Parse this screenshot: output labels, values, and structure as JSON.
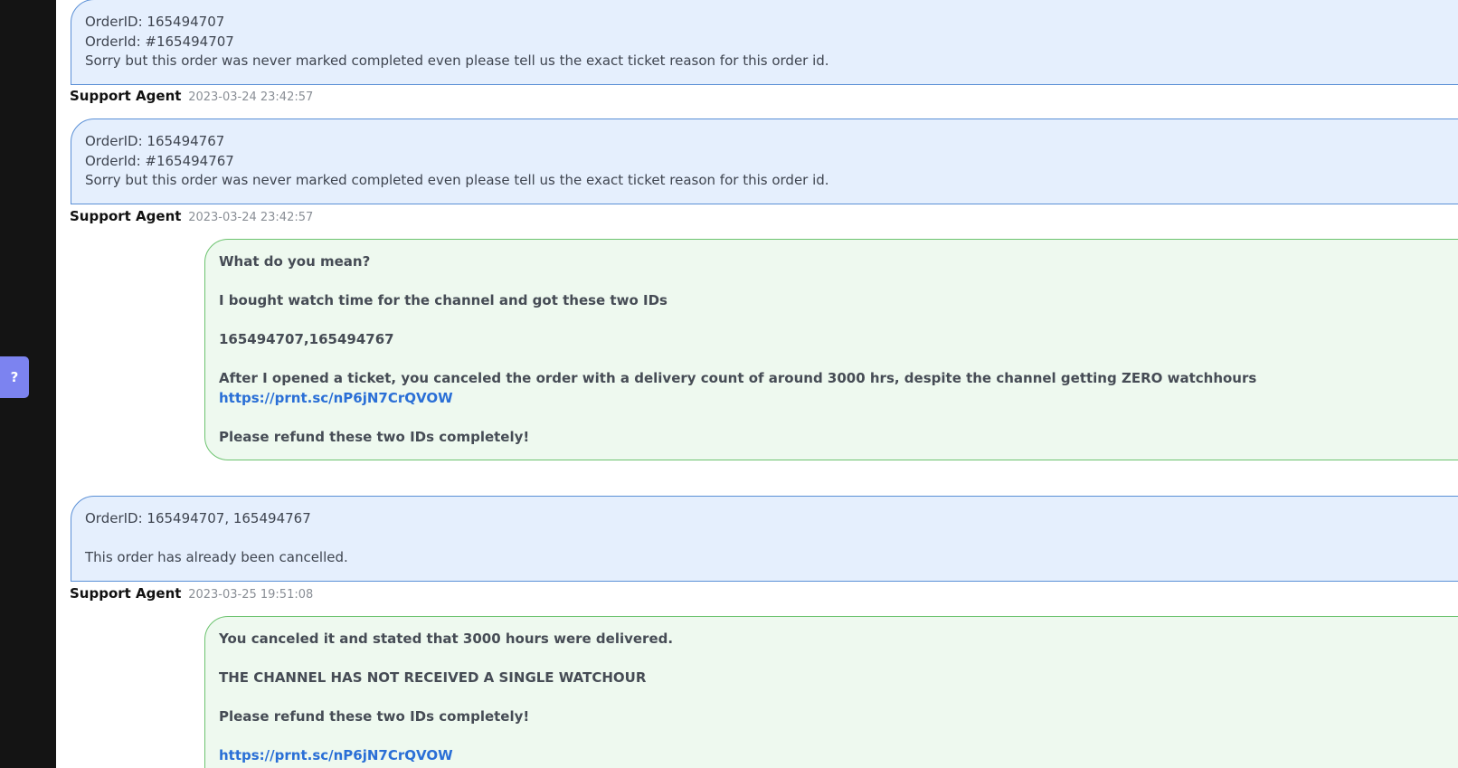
{
  "help_button": {
    "label": "?"
  },
  "messages": [
    {
      "lines": [
        "OrderID: 165494707",
        "OrderId: #165494707",
        "Sorry but this order was never marked completed even please tell us the exact ticket reason for this order id."
      ],
      "author": "Support Agent",
      "time": "2023-03-24 23:42:57"
    },
    {
      "lines": [
        "OrderID: 165494767",
        "OrderId: #165494767",
        "Sorry but this order was never marked completed even please tell us the exact ticket reason for this order id."
      ],
      "author": "Support Agent",
      "time": "2023-03-24 23:42:57"
    },
    {
      "lines": [
        "What do you mean?",
        "I bought watch time for the channel and got these two IDs",
        "165494707,165494767",
        "After I opened a ticket, you canceled the order with a delivery count of around 3000 hrs, despite the channel getting ZERO watchhours",
        "Please refund these two IDs completely!"
      ],
      "link": "https://prnt.sc/nP6jN7CrQVOW"
    },
    {
      "lines": [
        "OrderID: 165494707, 165494767",
        "This order has already been cancelled."
      ],
      "author": "Support Agent",
      "time": "2023-03-25 19:51:08"
    },
    {
      "lines": [
        "You canceled it and stated that 3000 hours were delivered.",
        "THE CHANNEL HAS NOT RECEIVED A SINGLE WATCHOUR",
        "Please refund these two IDs completely!"
      ],
      "link": "https://prnt.sc/nP6jN7CrQVOW"
    }
  ]
}
